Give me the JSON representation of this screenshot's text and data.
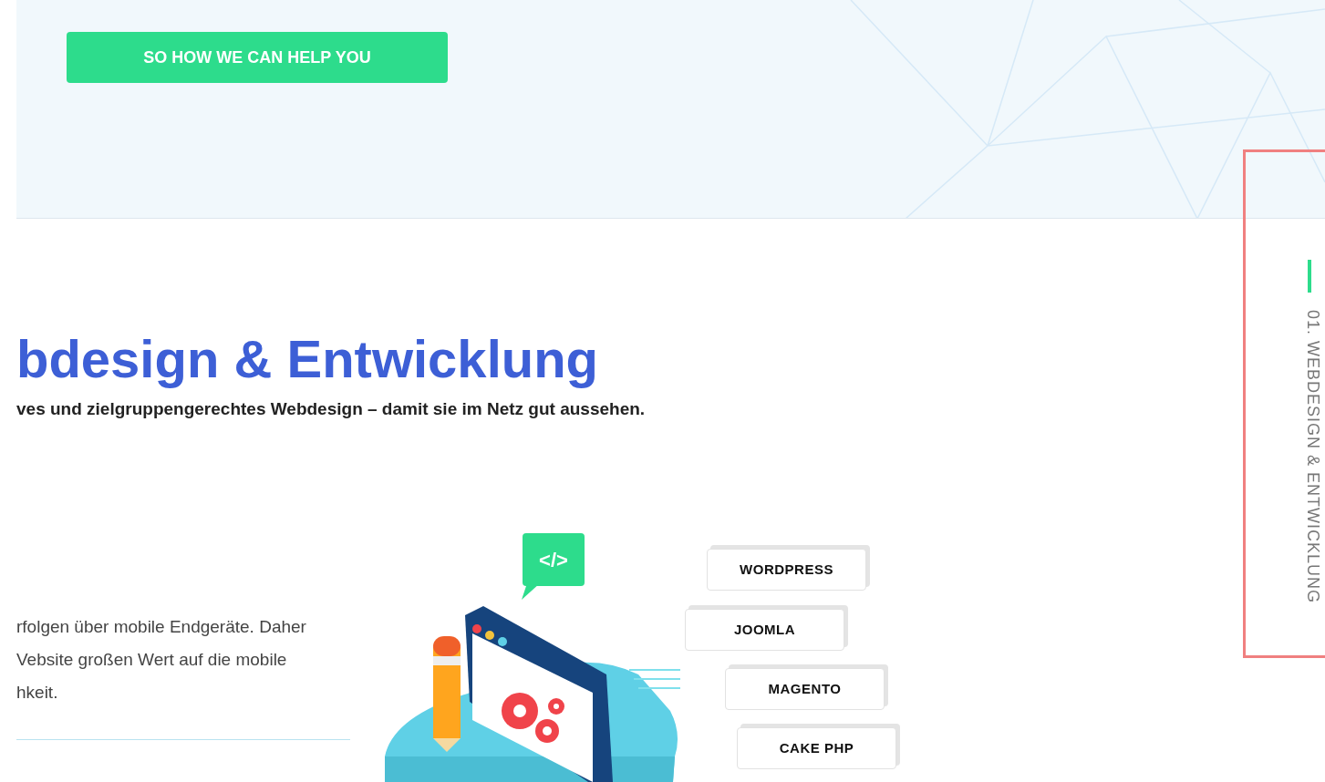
{
  "hero": {
    "button": "SO HOW WE CAN HELP YOU"
  },
  "section": {
    "heading": "bdesign & Entwicklung",
    "subtitle": "ves und zielgruppengerechtes Webdesign – damit sie im Netz gut aussehen.",
    "paragraph_lines": [
      "rfolgen über mobile Endgeräte. Daher",
      "Vebsite großen Wert auf die mobile",
      "hkeit."
    ]
  },
  "illustration": {
    "code_bubble": "</>",
    "tags": [
      "WORDPRESS",
      "JOOMLA",
      "MAGENTO",
      "CAKE PHP"
    ]
  },
  "side_nav": {
    "label": "01. WEBDESIGN & ENTWICKLUNG"
  }
}
